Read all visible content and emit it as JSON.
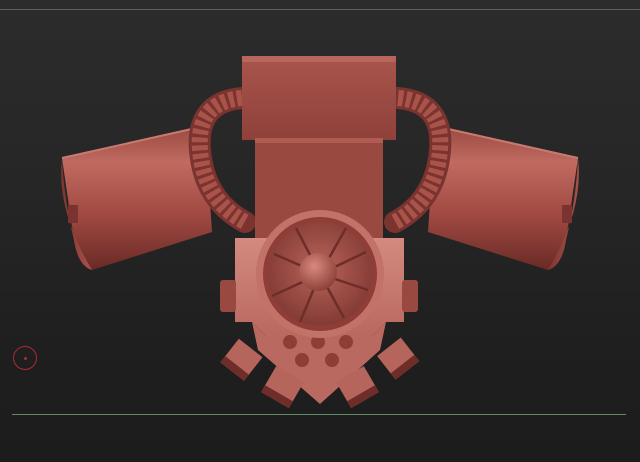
{
  "viewport": {
    "background": "#262626",
    "model": {
      "name": "sculpted-mech-backpack",
      "material_color": "#b15a52",
      "shadow_color": "#6e2d29",
      "highlight_color": "#d17c72"
    },
    "cursor": {
      "color": "#b02a2a"
    },
    "floor_grid": {
      "color": "#5f8a5f"
    }
  }
}
